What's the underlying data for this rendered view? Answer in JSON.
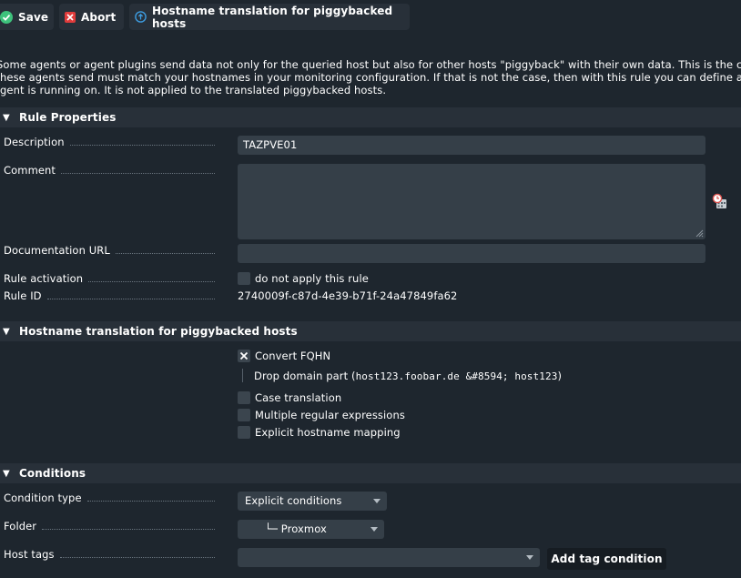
{
  "toolbar": {
    "save_label": "Save",
    "abort_label": "Abort",
    "help_label": "Hostname translation for piggybacked hosts"
  },
  "intro": {
    "line1": "Some agents or agent plugins send data not only for the queried host but also for other hosts \"piggyback\" with their own data. This is the ca",
    "line2": "hese agents send must match your hostnames in your monitoring configuration. If that is not the case, then with this rule you can define a h",
    "line3": "gent is running on. It is not applied to the translated piggybacked hosts."
  },
  "rule_properties": {
    "title": "Rule Properties",
    "description_label": "Description",
    "description_value": "TAZPVE01",
    "comment_label": "Comment",
    "comment_value": "",
    "doc_url_label": "Documentation URL",
    "doc_url_value": "",
    "activation_label": "Rule activation",
    "activation_checkbox_label": "do not apply this rule",
    "rule_id_label": "Rule ID",
    "rule_id_value": "2740009f-c87d-4e39-b71f-24a47849fa62"
  },
  "translation": {
    "title": "Hostname translation for piggybacked hosts",
    "convert_fqhn_label": "Convert FQHN",
    "drop_domain_prefix": "Drop domain part (",
    "drop_domain_code": "host123.foobar.de &#8594; host123",
    "drop_domain_suffix": ")",
    "case_translation_label": "Case translation",
    "regex_label": "Multiple regular expressions",
    "mapping_label": "Explicit hostname mapping"
  },
  "conditions": {
    "title": "Conditions",
    "condition_type_label": "Condition type",
    "condition_type_value": "Explicit conditions",
    "folder_label": "Folder",
    "folder_value": "└─ Proxmox",
    "host_tags_label": "Host tags",
    "host_tags_value": "",
    "add_tag_label": "Add tag condition"
  },
  "colors": {
    "background": "#1e262e",
    "section_header": "#283039",
    "input": "#353f48",
    "save_green": "#3ec27c",
    "abort_red": "#e03b3b",
    "help_blue": "#3d9ce0"
  }
}
